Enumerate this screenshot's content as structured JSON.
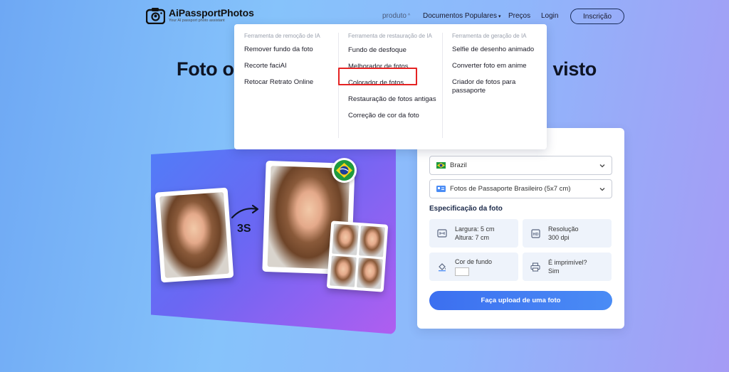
{
  "header": {
    "logo_name": "AiPassportPhotos",
    "logo_tagline": "Your AI passport photo assistant",
    "nav": {
      "produto": "produto",
      "documentos": "Documentos Populares",
      "precos": "Preços",
      "login": "Login"
    },
    "signup_label": "Inscrição"
  },
  "hero": {
    "title_left": "Foto o",
    "title_right": "visto"
  },
  "dropdown": {
    "columns": [
      {
        "heading": "Ferramenta de remoção de IA",
        "items": [
          "Remover fundo da foto",
          "Recorte faciAI",
          "Retocar Retrato Online"
        ]
      },
      {
        "heading": "Ferramenta de restauração de IA",
        "items": [
          "Fundo de desfoque",
          "Melhorador de fotos",
          "Colorador de fotos",
          "Restauração de fotos antigas",
          "Correção de cor da foto"
        ]
      },
      {
        "heading": "Ferramenta de geração de IA",
        "items": [
          "Selfie de desenho animado",
          "Converter foto em anime",
          "Criador de fotos para passaporte"
        ]
      }
    ]
  },
  "illustration": {
    "timer_label": "3S"
  },
  "form": {
    "country": "Brazil",
    "document": "Fotos de Passaporte Brasileiro (5x7 cm)",
    "spec_title": "Especificação da foto",
    "specs": {
      "width": "Largura: 5 cm",
      "height": "Altura: 7 cm",
      "resolution_label": "Resolução",
      "resolution_value": "300 dpi",
      "bg_label": "Cor de fundo",
      "printable_label": "É imprimível?",
      "printable_value": "Sim"
    },
    "upload_label": "Faça upload de uma foto"
  },
  "colors": {
    "accent": "#3c6ff0",
    "highlight": "#e52323"
  }
}
